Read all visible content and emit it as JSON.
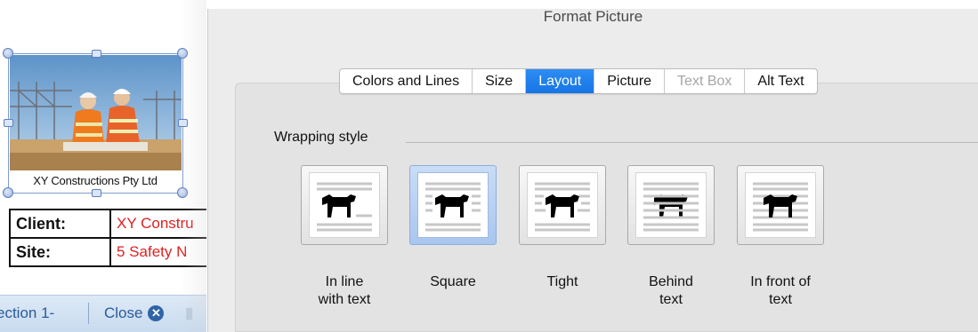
{
  "document": {
    "caption": "XY Constructions Pty Ltd",
    "table": [
      {
        "label": "Client:",
        "value": "XY Constru"
      },
      {
        "label": "Site:",
        "value": "5 Safety N"
      }
    ],
    "statusbar": {
      "section": "ection 1-",
      "close": "Close"
    }
  },
  "dialog": {
    "title": "Format Picture",
    "tabs": [
      {
        "label": "Colors and Lines",
        "state": "normal"
      },
      {
        "label": "Size",
        "state": "normal"
      },
      {
        "label": "Layout",
        "state": "active"
      },
      {
        "label": "Picture",
        "state": "normal"
      },
      {
        "label": "Text Box",
        "state": "disabled"
      },
      {
        "label": "Alt Text",
        "state": "normal"
      }
    ],
    "wrapping": {
      "heading": "Wrapping style",
      "options": [
        {
          "label": "In line with text",
          "line1": "In line",
          "line2": "with text",
          "selected": false
        },
        {
          "label": "Square",
          "line1": "Square",
          "line2": "",
          "selected": true
        },
        {
          "label": "Tight",
          "line1": "Tight",
          "line2": "",
          "selected": false
        },
        {
          "label": "Behind text",
          "line1": "Behind",
          "line2": "text",
          "selected": false
        },
        {
          "label": "In front of text",
          "line1": "In front of",
          "line2": "text",
          "selected": false
        }
      ]
    }
  },
  "colors": {
    "accent": "#1675e6",
    "value_text": "#dd2222",
    "statusbar_text": "#2a5a9a"
  }
}
